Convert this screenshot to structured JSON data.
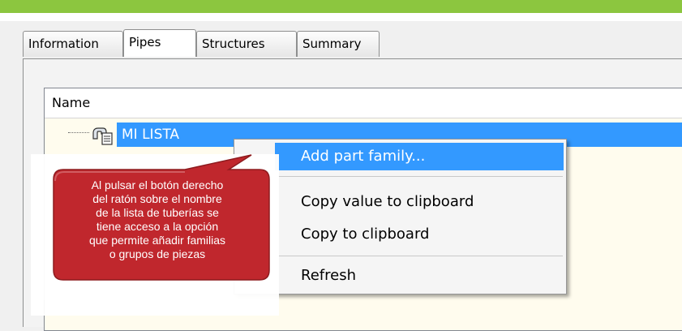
{
  "tabs": [
    {
      "label": "Information"
    },
    {
      "label": "Pipes"
    },
    {
      "label": "Structures"
    },
    {
      "label": "Summary"
    }
  ],
  "active_tab": "Pipes",
  "list": {
    "header": "Name",
    "items": [
      {
        "label": "MI LISTA",
        "icon": "pipe-list-icon",
        "selected": true
      }
    ]
  },
  "context_menu": {
    "items": [
      {
        "label": "Add part family..."
      },
      {
        "label": "Copy value to clipboard"
      },
      {
        "label": "Copy to clipboard"
      },
      {
        "label": "Refresh"
      }
    ]
  },
  "callout": {
    "lines": [
      "Al pulsar el botón derecho",
      "del ratón sobre el nombre",
      "de la lista de tuberías se",
      "tiene acceso a la opción",
      "que permite añadir familias",
      "o grupos de piezas"
    ]
  },
  "colors": {
    "accent_bar": "#8cc63f",
    "selection": "#3399ff",
    "callout_fill": "#c0272d"
  }
}
